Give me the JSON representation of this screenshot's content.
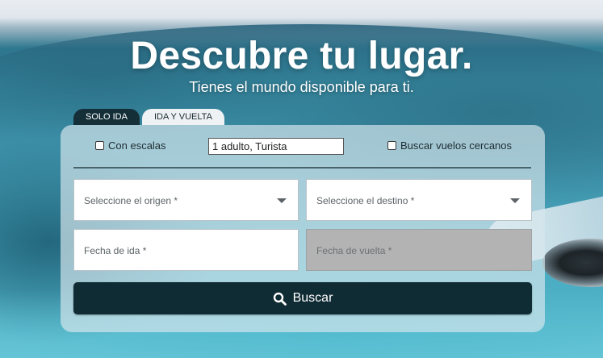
{
  "hero": {
    "title": "Descubre tu lugar.",
    "subtitle": "Tienes el mundo disponible para ti."
  },
  "tabs": [
    {
      "label": "SOLO IDA",
      "active": false
    },
    {
      "label": "IDA Y VUELTA",
      "active": true
    }
  ],
  "options": {
    "stops_label": "Con escalas",
    "stops_checked": false,
    "passengers_value": "1 adulto, Turista",
    "nearby_label": "Buscar vuelos cercanos",
    "nearby_checked": false
  },
  "form": {
    "origin_placeholder": "Seleccione el origen *",
    "destination_placeholder": "Seleccione el destino *",
    "departure_placeholder": "Fecha de ida *",
    "return_placeholder": "Fecha de vuelta *"
  },
  "search_button": {
    "label": "Buscar",
    "icon": "search-icon"
  },
  "colors": {
    "tab_active_dark": "#142f38",
    "button_bg": "#0f2b33",
    "disabled_field": "#b3b3b3"
  }
}
